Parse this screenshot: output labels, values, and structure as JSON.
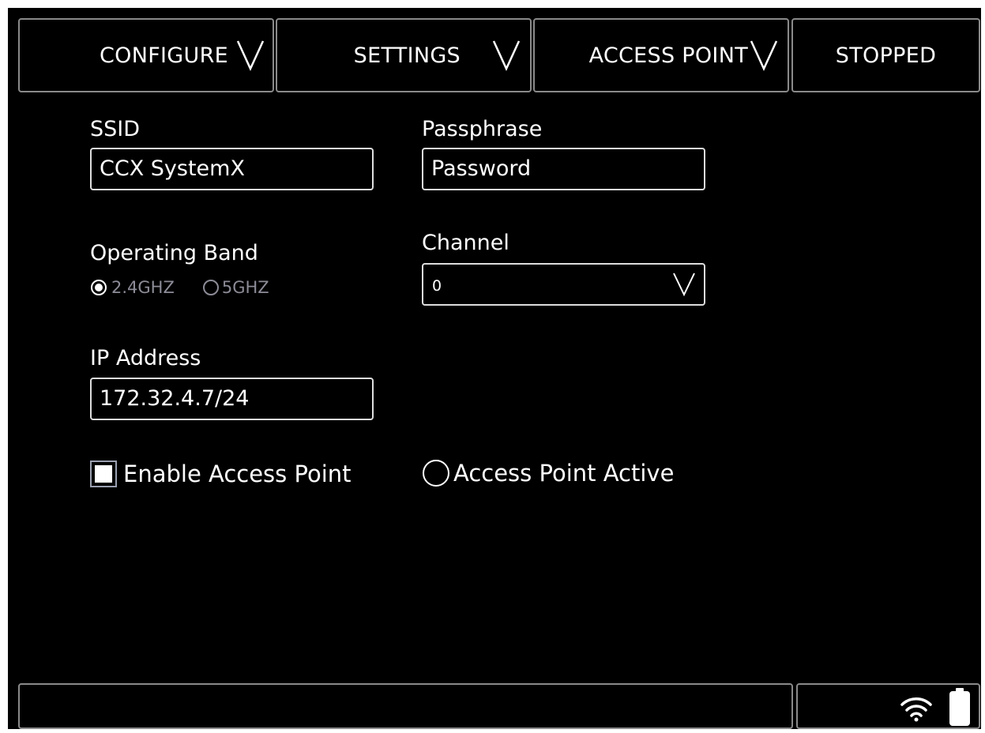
{
  "header": {
    "tabs": [
      {
        "label": "CONFIGURE",
        "has_chevron": true
      },
      {
        "label": "SETTINGS",
        "has_chevron": true
      },
      {
        "label": "ACCESS POINT",
        "has_chevron": true
      },
      {
        "label": "STOPPED",
        "has_chevron": false
      }
    ]
  },
  "form": {
    "ssid": {
      "label": "SSID",
      "value": "CCX SystemX"
    },
    "passphrase": {
      "label": "Passphrase",
      "value": "Password"
    },
    "operating_band": {
      "label": "Operating Band",
      "options": [
        {
          "label": "2.4GHZ",
          "selected": true
        },
        {
          "label": "5GHZ",
          "selected": false
        }
      ]
    },
    "channel": {
      "label": "Channel",
      "value": "0"
    },
    "ip_address": {
      "label": "IP Address",
      "value": "172.32.4.7/24"
    },
    "enable_access_point": {
      "label": "Enable Access Point",
      "checked": true
    },
    "access_point_active": {
      "label": "Access Point Active",
      "active": false
    }
  },
  "status_bar": {
    "icons": [
      "wifi-icon",
      "battery-icon"
    ]
  },
  "colors": {
    "background": "#000000",
    "border": "#8a8a8a",
    "muted_text": "#8c8c98",
    "text": "#ffffff"
  }
}
